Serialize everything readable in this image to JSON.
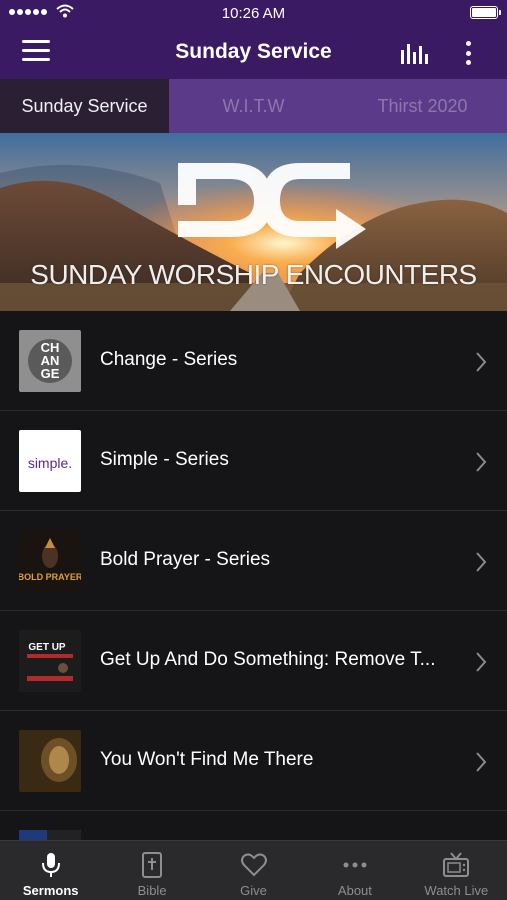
{
  "status_bar": {
    "time": "10:26 AM"
  },
  "nav": {
    "title": "Sunday Service"
  },
  "tabs": [
    {
      "label": "Sunday Service",
      "active": true
    },
    {
      "label": "W.I.T.W",
      "active": false
    },
    {
      "label": "Thirst 2020",
      "active": false
    }
  ],
  "banner": {
    "logo_text": "DC",
    "caption": "SUNDAY WORSHIP ENCOUNTERS"
  },
  "sermons": [
    {
      "title": "Change - Series",
      "thumb_text": "CH AN GE"
    },
    {
      "title": "Simple - Series",
      "thumb_text": "simple."
    },
    {
      "title": "Bold Prayer - Series",
      "thumb_text": "BOLD PRAYER"
    },
    {
      "title": "Get Up And Do Something: Remove T...",
      "thumb_text": "GET UP"
    },
    {
      "title": "You Won't Find Me There",
      "thumb_text": ""
    }
  ],
  "tabbar": [
    {
      "label": "Sermons",
      "icon": "microphone-icon",
      "active": true
    },
    {
      "label": "Bible",
      "icon": "bible-icon",
      "active": false
    },
    {
      "label": "Give",
      "icon": "heart-icon",
      "active": false
    },
    {
      "label": "About",
      "icon": "more-horizontal-icon",
      "active": false
    },
    {
      "label": "Watch Live",
      "icon": "tv-icon",
      "active": false
    }
  ],
  "colors": {
    "header": "#3a1a62",
    "tabs": "#5c3a8a",
    "active_tab": "#2b2033",
    "background": "#151517",
    "tabbar": "#2a2a2d"
  }
}
